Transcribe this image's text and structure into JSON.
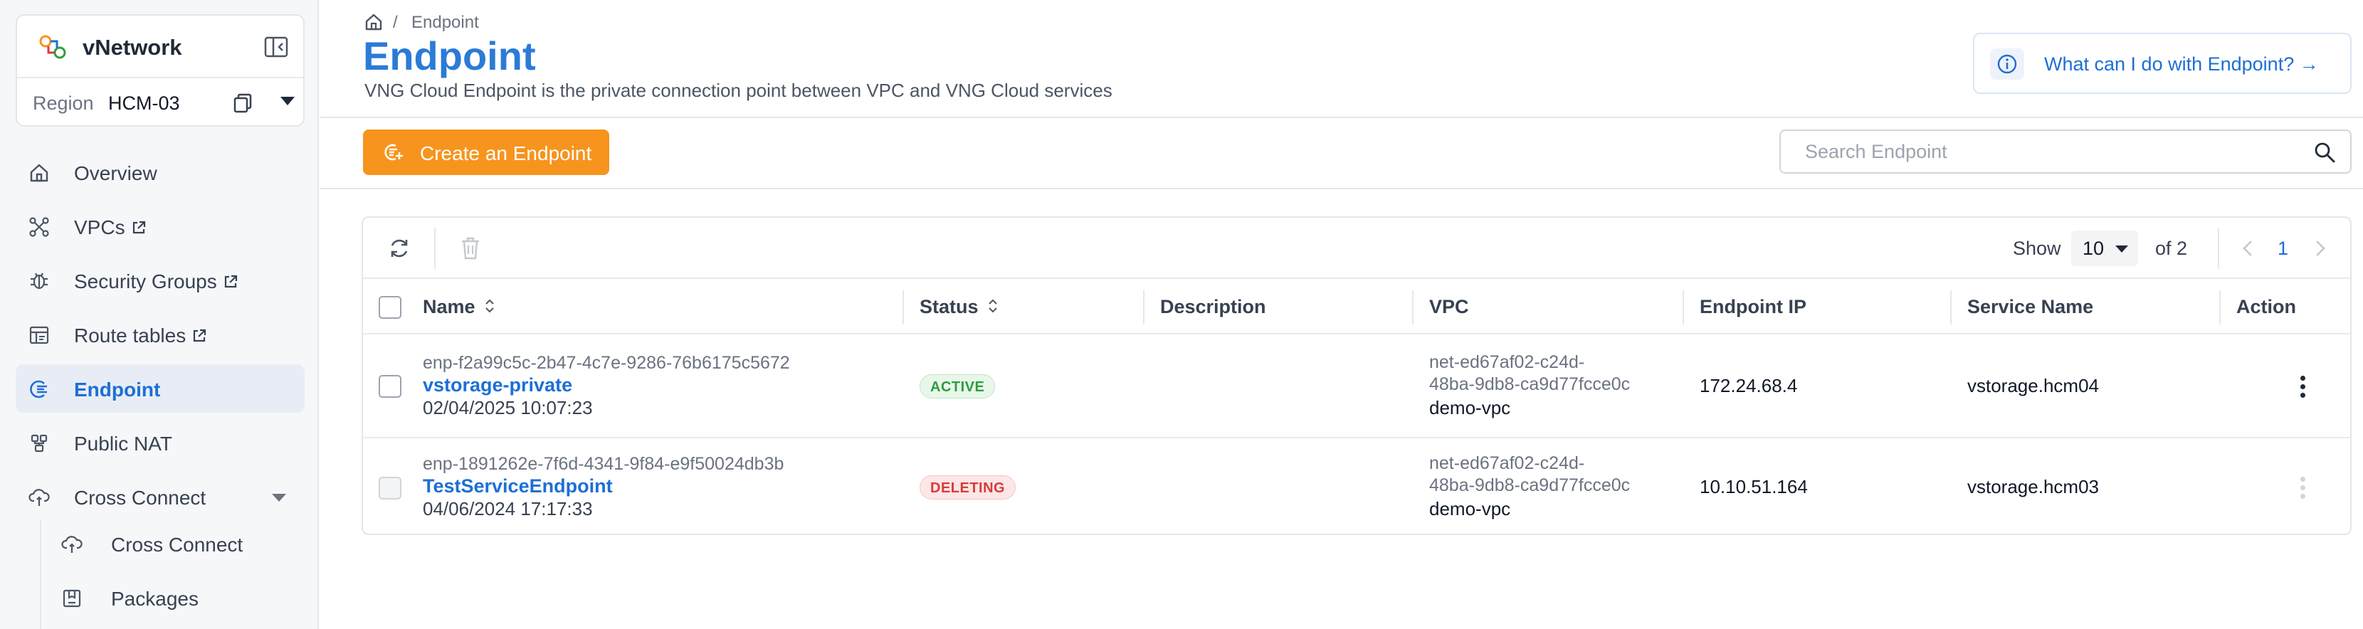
{
  "sidebar": {
    "brand_name": "vNetwork",
    "region_label": "Region",
    "region_value": "HCM-03",
    "nav": [
      {
        "label": "Overview",
        "icon": "home-icon"
      },
      {
        "label": "VPCs",
        "icon": "network-icon",
        "external": true
      },
      {
        "label": "Security Groups",
        "icon": "shield-bug-icon",
        "external": true
      },
      {
        "label": "Route tables",
        "icon": "table-icon",
        "external": true
      },
      {
        "label": "Endpoint",
        "icon": "endpoint-icon",
        "active": true
      },
      {
        "label": "Public NAT",
        "icon": "nat-icon"
      },
      {
        "label": "Cross Connect",
        "icon": "cloud-connect-icon",
        "expandable": true
      }
    ],
    "sub_nav": [
      {
        "label": "Cross Connect",
        "icon": "cloud-connect-icon"
      },
      {
        "label": "Packages",
        "icon": "package-icon"
      }
    ]
  },
  "header": {
    "breadcrumb_sep": "/",
    "breadcrumb_current": "Endpoint",
    "title": "Endpoint",
    "description": "VNG Cloud Endpoint is the private connection point between VPC and VNG Cloud services",
    "help_text": "What can I do with Endpoint? →"
  },
  "actions": {
    "create_label": "Create an Endpoint",
    "search_placeholder": "Search Endpoint"
  },
  "table": {
    "show_label": "Show",
    "page_size": "10",
    "of_label": "of 2",
    "current_page": "1",
    "columns": [
      "Name",
      "Status",
      "Description",
      "VPC",
      "Endpoint IP",
      "Service Name",
      "Action"
    ],
    "rows": [
      {
        "id": "enp-f2a99c5c-2b47-4c7e-9286-76b6175c5672",
        "name": "vstorage-private",
        "date": "02/04/2025 10:07:23",
        "status": "ACTIVE",
        "description": "",
        "vpc_id_line1": "net-ed67af02-c24d-",
        "vpc_id_line2": "48ba-9db8-ca9d77fcce0c",
        "vpc_name": "demo-vpc",
        "endpoint_ip": "172.24.68.4",
        "service_name": "vstorage.hcm04"
      },
      {
        "id": "enp-1891262e-7f6d-4341-9f84-e9f50024db3b",
        "name": "TestServiceEndpoint",
        "date": "04/06/2024 17:17:33",
        "status": "DELETING",
        "description": "",
        "vpc_id_line1": "net-ed67af02-c24d-",
        "vpc_id_line2": "48ba-9db8-ca9d77fcce0c",
        "vpc_name": "demo-vpc",
        "endpoint_ip": "10.10.51.164",
        "service_name": "vstorage.hcm03"
      }
    ]
  },
  "colors": {
    "accent": "#1d6fd6",
    "primary_button": "#f7941d",
    "active_badge": "#2e9d3f",
    "deleting_badge": "#d83a3a"
  }
}
